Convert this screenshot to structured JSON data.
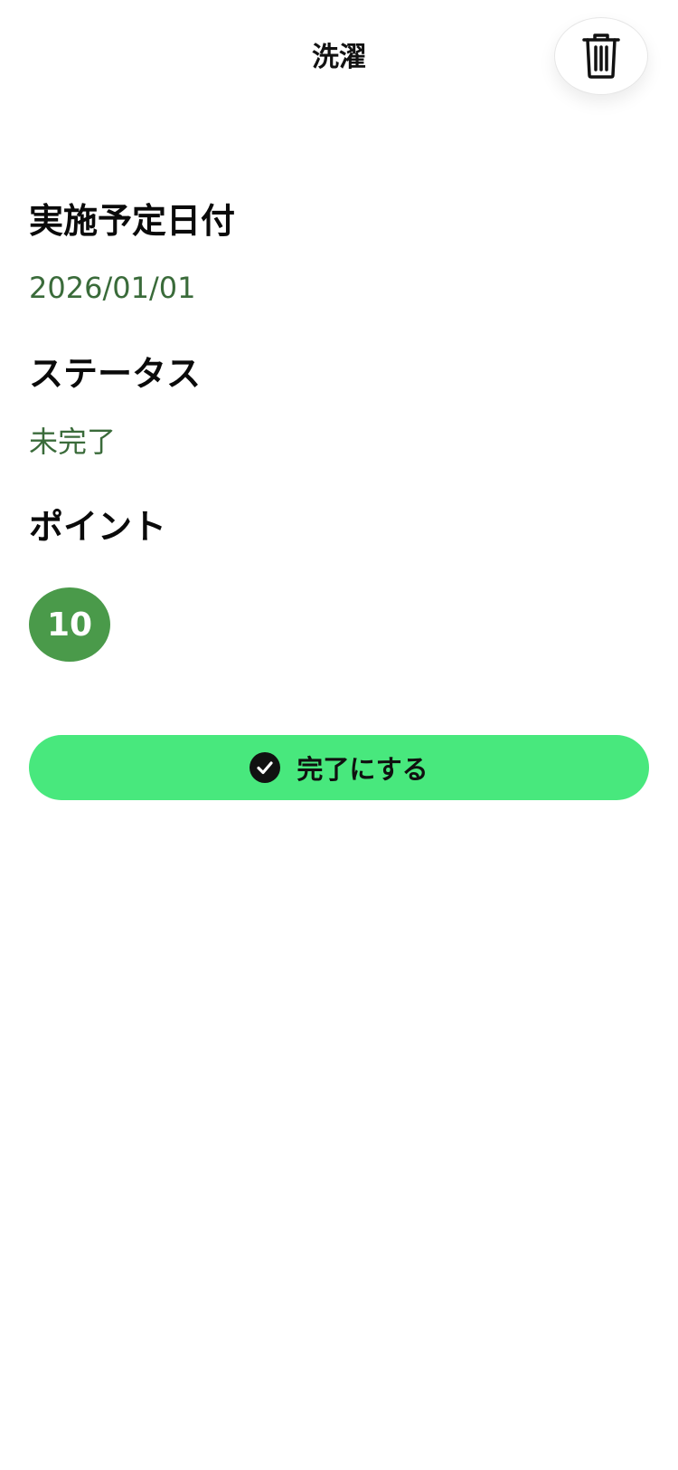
{
  "header": {
    "title": "洗濯",
    "delete_icon": "trash-icon"
  },
  "details": {
    "date_heading": "実施予定日付",
    "date_value": "2026/01/01",
    "status_heading": "ステータス",
    "status_value": "未完了",
    "points_heading": "ポイント",
    "points_value": "10"
  },
  "actions": {
    "complete_label": "完了にする",
    "complete_icon": "check-circle-icon"
  },
  "colors": {
    "accent": "#48e87d",
    "value_text": "#3a6b3a",
    "badge": "#4a9a4a"
  }
}
